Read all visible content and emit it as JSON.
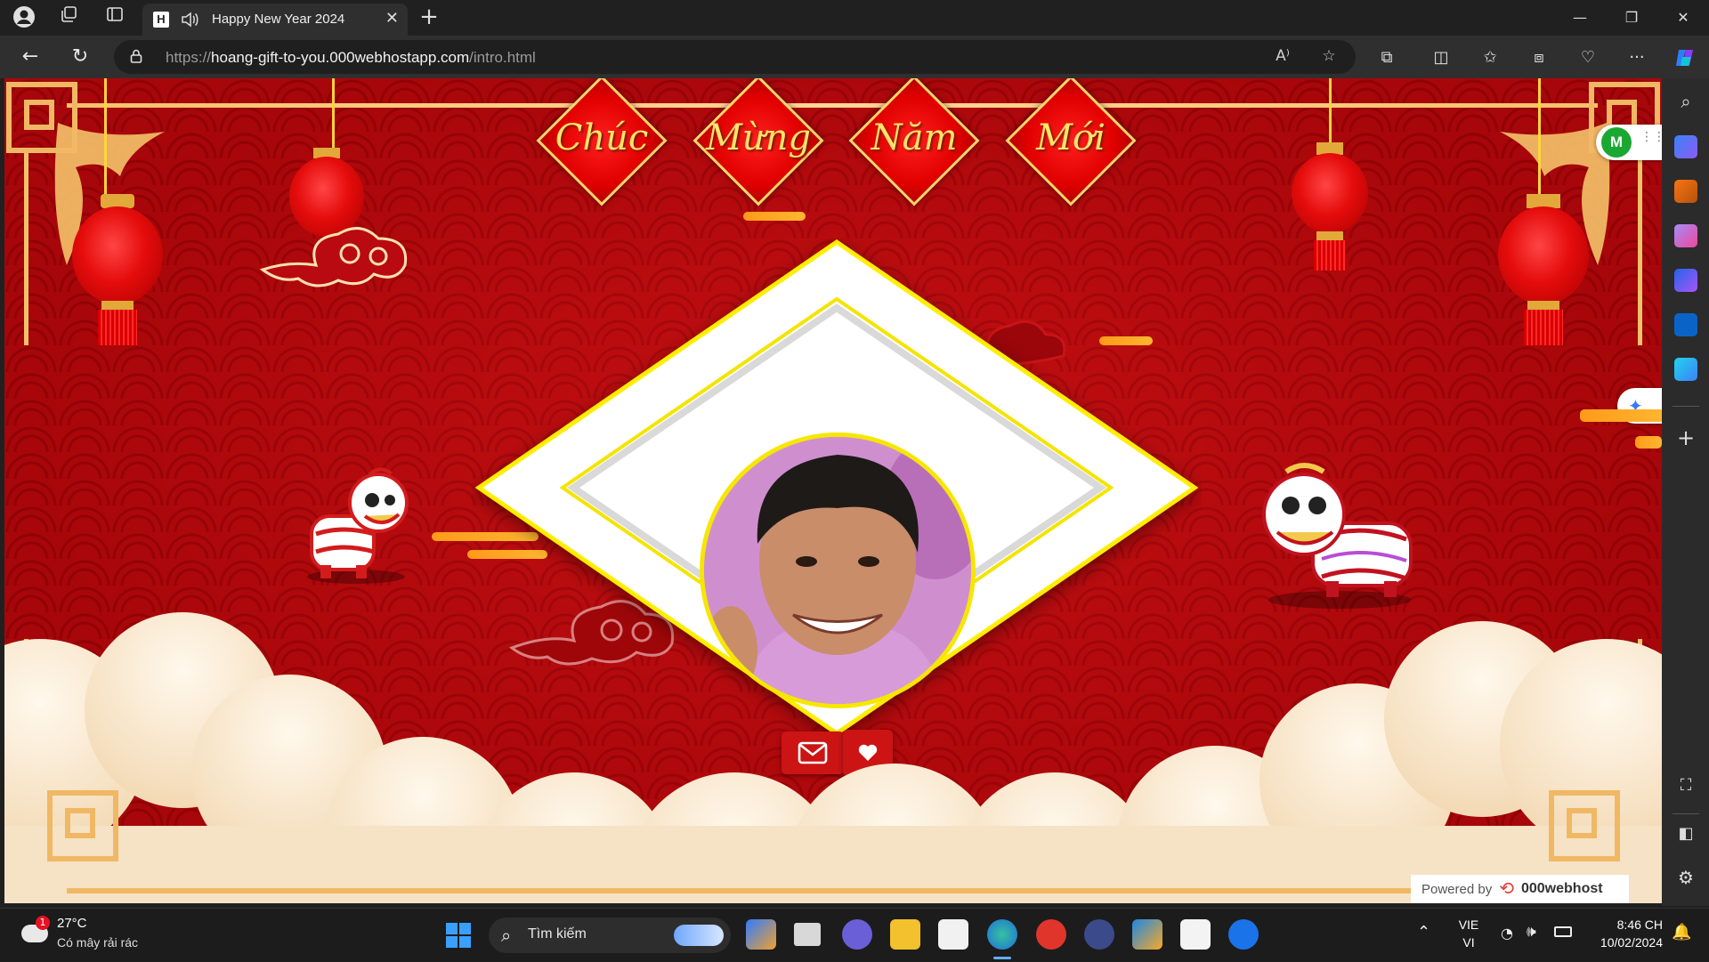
{
  "browser": {
    "tab": {
      "favicon_letter": "H",
      "title": "Happy New Year 2024"
    },
    "url": {
      "scheme": "https://",
      "host": "hoang-gift-to-you.000webhostapp.com",
      "path": "/intro.html"
    }
  },
  "page": {
    "banner": [
      "Chúc",
      "Mừng",
      "Năm",
      "Mới"
    ],
    "powered_by": {
      "prefix": "Powered by",
      "brand": "000webhost"
    },
    "extension_badge": "M"
  },
  "taskbar": {
    "weather": {
      "badge": "1",
      "temp": "27°C",
      "desc": "Có mây rải rác"
    },
    "search_label": "Tìm kiếm",
    "language": {
      "line1": "VIE",
      "line2": "VI"
    },
    "clock": {
      "time": "8:46 CH",
      "date": "10/02/2024"
    }
  },
  "colors": {
    "page_red": "#b3080c",
    "gold": "#f5c26b",
    "frame_yellow": "#ffee00",
    "button_red": "#cc1414"
  }
}
